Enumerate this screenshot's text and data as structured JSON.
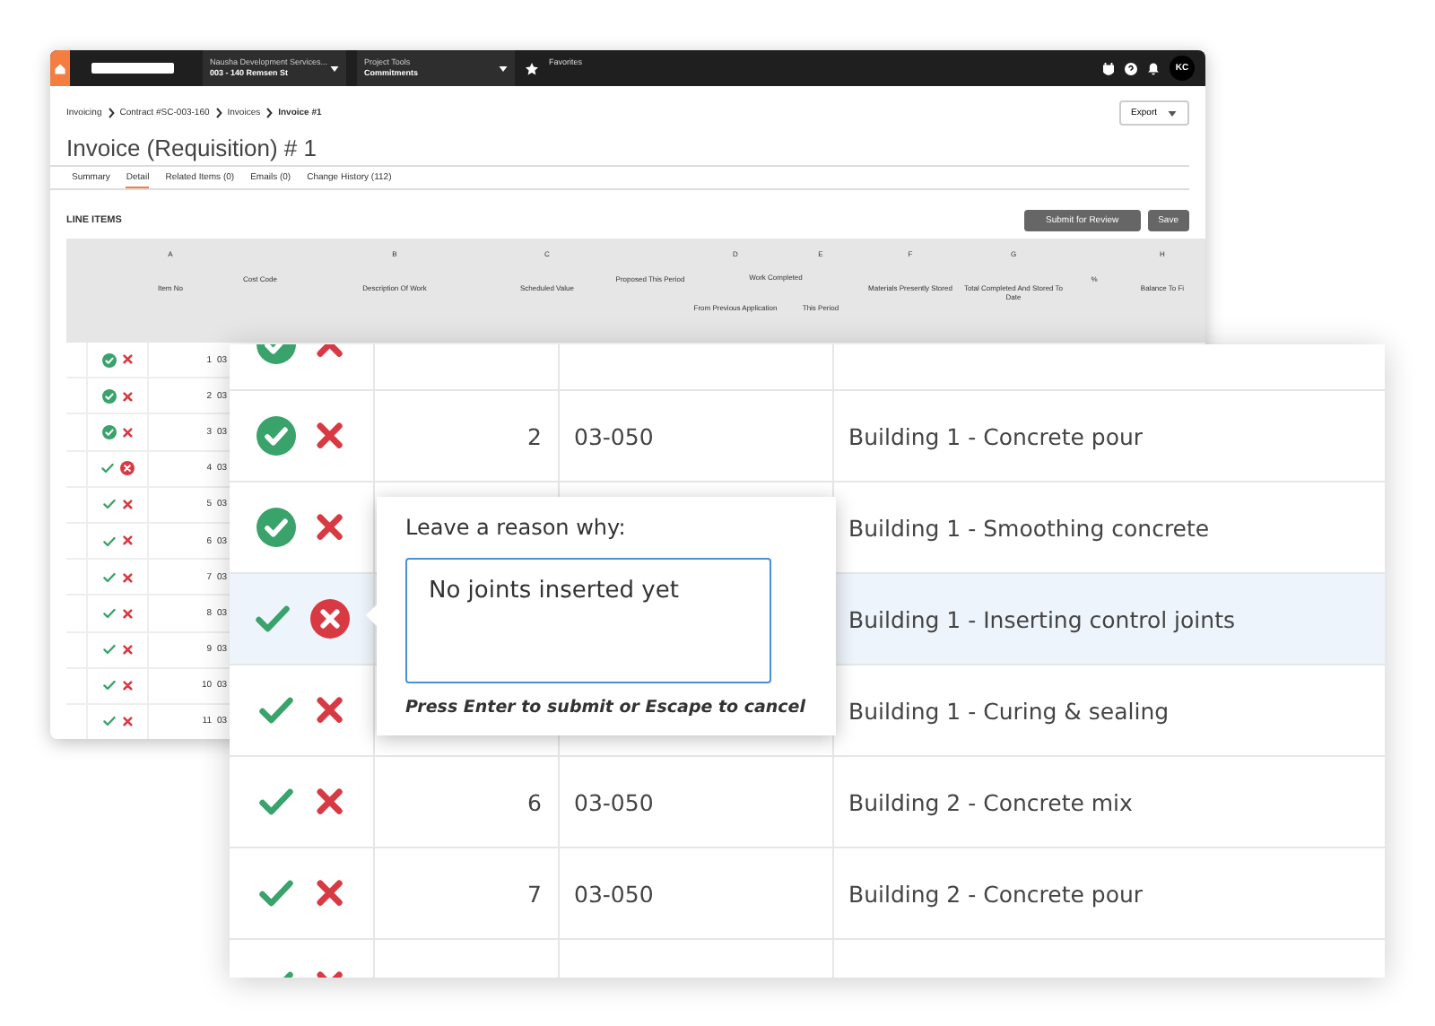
{
  "top_bar": {
    "project": {
      "label": "Nausha Development Services...",
      "value": "003 - 140 Remsen St"
    },
    "tool": {
      "label": "Project Tools",
      "value": "Commitments"
    },
    "favorites": "Favorites",
    "avatar": "KC"
  },
  "breadcrumbs": [
    "Invoicing",
    "Contract #SC-003-160",
    "Invoices",
    "Invoice #1"
  ],
  "export": "Export",
  "title": "Invoice (Requisition) # 1",
  "tabs": [
    {
      "label": "Summary",
      "selected": false
    },
    {
      "label": "Detail",
      "selected": true
    },
    {
      "label": "Related Items (0)",
      "selected": false
    },
    {
      "label": "Emails (0)",
      "selected": false
    },
    {
      "label": "Change History (112)",
      "selected": false
    }
  ],
  "section_title": "LINE ITEMS",
  "buttons": [
    "Submit for Review",
    "Save"
  ],
  "columns": [
    {
      "letter": "A",
      "label": "Item No"
    },
    {
      "label": "Cost Code"
    },
    {
      "letter": "B",
      "label": "Description Of Work"
    },
    {
      "letter": "C",
      "label": "Scheduled Value"
    },
    {
      "label": "Proposed This Period"
    },
    {
      "label": "Work Completed",
      "children": [
        {
          "letter": "D",
          "label": "From Previous Application"
        },
        {
          "letter": "E",
          "label": "This Period"
        }
      ]
    },
    {
      "letter": "F",
      "label": "Materials Presently Stored"
    },
    {
      "letter": "G",
      "label": "Total Completed And Stored To Date"
    },
    {
      "label": "%"
    },
    {
      "letter": "H",
      "label": "Balance To Fi"
    }
  ],
  "rows": [
    {
      "number": "1",
      "cost_code": "03",
      "approved": true,
      "rejected": false
    },
    {
      "number": "2",
      "cost_code": "03",
      "approved": true,
      "rejected": false
    },
    {
      "number": "3",
      "cost_code": "03",
      "approved": true,
      "rejected": false
    },
    {
      "number": "4",
      "cost_code": "03",
      "approved": false,
      "rejected": true
    },
    {
      "number": "5",
      "cost_code": "03",
      "approved": false,
      "rejected": false
    },
    {
      "number": "6",
      "cost_code": "03",
      "approved": false,
      "rejected": false
    },
    {
      "number": "7",
      "cost_code": "03",
      "approved": false,
      "rejected": false
    },
    {
      "number": "8",
      "cost_code": "03",
      "approved": false,
      "rejected": false
    },
    {
      "number": "9",
      "cost_code": "03",
      "approved": false,
      "rejected": false
    },
    {
      "number": "10",
      "cost_code": "03",
      "approved": false,
      "rejected": false
    },
    {
      "number": "11",
      "cost_code": "03",
      "approved": false,
      "rejected": false
    }
  ],
  "detail_rows": [
    {
      "approved": true,
      "rejected": false,
      "selected": false
    },
    {
      "number": "2",
      "cost_code": "03-050",
      "description": "Building 1 - Concrete pour",
      "approved": true,
      "rejected": false,
      "selected": false
    },
    {
      "description": "Building 1 - Smoothing concrete",
      "approved": true,
      "rejected": false,
      "selected": false
    },
    {
      "description": "Building 1 - Inserting control joints",
      "approved": false,
      "rejected": true,
      "selected": true
    },
    {
      "description": "Building 1 - Curing & sealing",
      "approved": false,
      "rejected": false,
      "selected": false
    },
    {
      "number": "6",
      "cost_code": "03-050",
      "description": "Building 2 - Concrete mix",
      "approved": false,
      "rejected": false,
      "selected": false
    },
    {
      "number": "7",
      "cost_code": "03-050",
      "description": "Building 2 - Concrete pour",
      "approved": false,
      "rejected": false,
      "selected": false
    },
    {
      "approved": false,
      "rejected": false,
      "selected": false
    }
  ],
  "popover": {
    "title": "Leave a reason why:",
    "value": "No joints inserted yet",
    "hint": "Press Enter to submit or Escape to cancel"
  }
}
